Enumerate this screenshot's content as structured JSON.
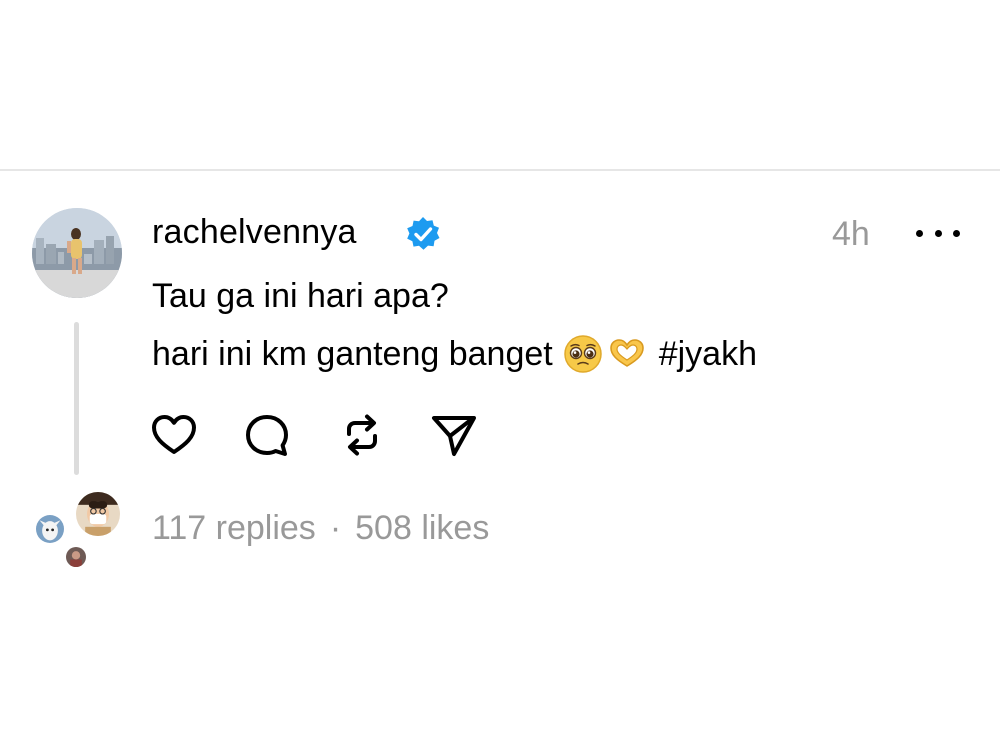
{
  "post": {
    "username": "rachelvennya",
    "verified": true,
    "timestamp": "4h",
    "text_line1": "Tau ga ini hari apa?",
    "text_line2": "hari ini km ganteng banget",
    "emojis": [
      "pleading-face-emoji",
      "heart-hands-emoji"
    ],
    "hashtag": "#jyakh"
  },
  "actions": [
    "heart-icon",
    "comment-icon",
    "repost-icon",
    "share-icon"
  ],
  "stats": {
    "replies": "117 replies",
    "separator": "·",
    "likes": "508 likes"
  },
  "colors": {
    "verified_blue": "#1d9bf0",
    "muted_text": "#999999",
    "thread_line": "#dcdcdc",
    "divider": "#e6e6e6"
  }
}
